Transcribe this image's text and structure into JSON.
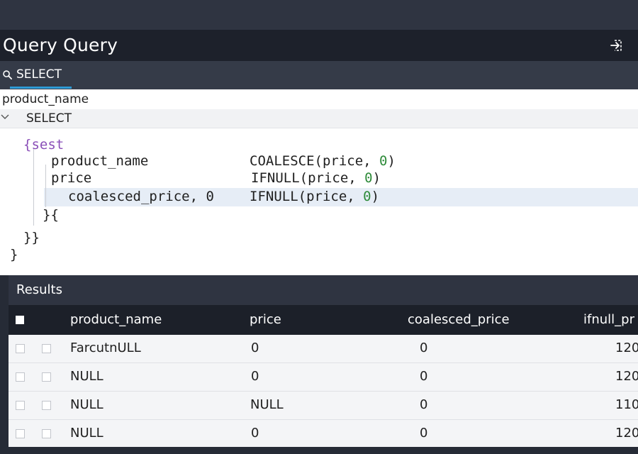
{
  "window": {
    "title": "Query Query"
  },
  "tab": {
    "label": "SELECT"
  },
  "editor": {
    "breadcrumb": "product_name",
    "section_label": "SELECT",
    "lines": [
      {
        "left": "{sest",
        "right": ""
      },
      {
        "left": "product_name",
        "right_pre": "COALESCE(price, ",
        "right_num": "0",
        "right_post": ")"
      },
      {
        "left": "price",
        "right_pre": "IFNULL(price, ",
        "right_num": "0",
        "right_post": ")"
      },
      {
        "left_pre": "coalesced_price, ",
        "left_num": "0",
        "right_pre": "IFNULL(price, ",
        "right_num": "0",
        "right_post": ")"
      },
      {
        "left": "}{"
      },
      {
        "left": "}}"
      },
      {
        "left": "}"
      }
    ]
  },
  "results": {
    "title": "Results",
    "columns": [
      "product_name",
      "price",
      "coalesced_price",
      "ifnull_pr"
    ],
    "rows": [
      [
        "FarcutnULL",
        "0",
        "0",
        "120"
      ],
      [
        "NULL",
        "0",
        "0",
        "120"
      ],
      [
        "NULL",
        "NULL",
        "0",
        "110"
      ],
      [
        "NULL",
        "0",
        "0",
        "120"
      ]
    ]
  },
  "colors": {
    "accent": "#2e9bd6",
    "keyword": "#8a4fb8",
    "number": "#2e8b3a",
    "title_bar": "#1d212b",
    "header_dark": "#1c2029"
  },
  "icons": {
    "exit": "exit-arrow-icon",
    "search": "search-icon",
    "chevron": "chevron-down-icon"
  }
}
